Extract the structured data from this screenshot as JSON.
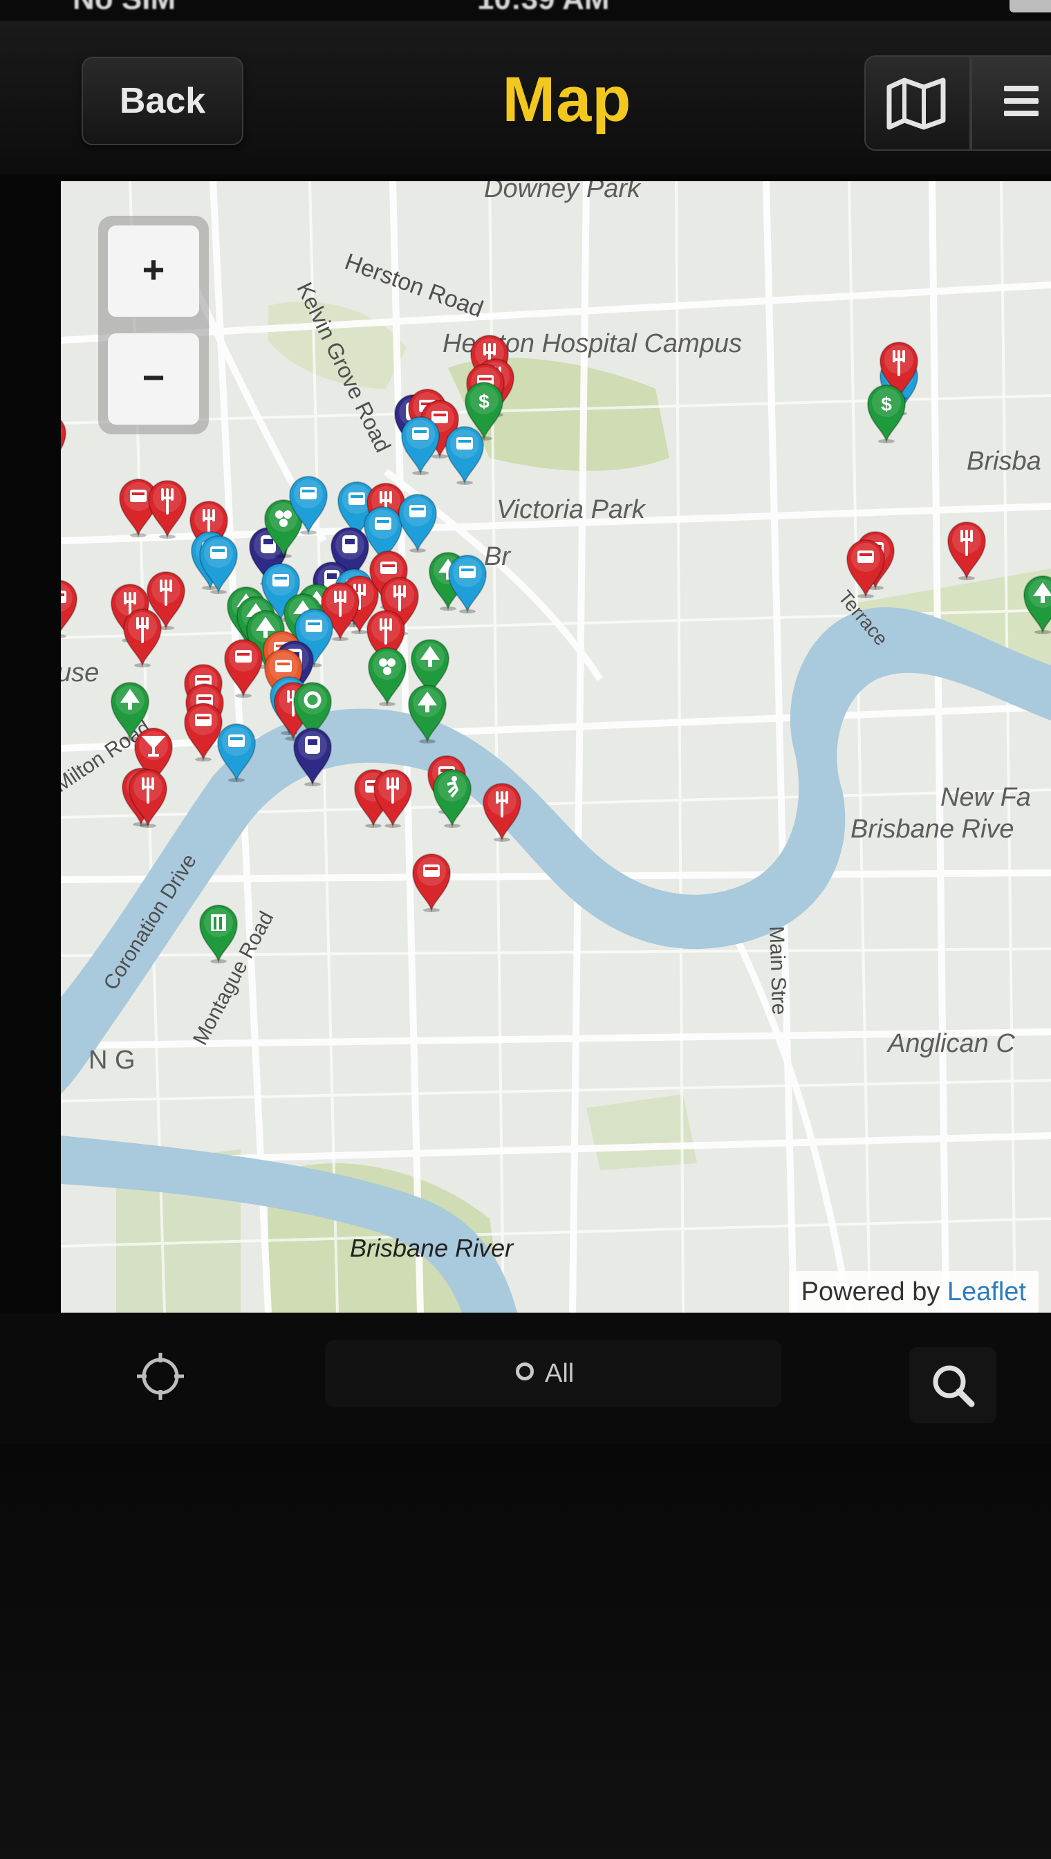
{
  "status_bar": {
    "carrier": "No SIM",
    "time": "10:39 AM"
  },
  "nav": {
    "back_label": "Back",
    "title": "Map"
  },
  "map": {
    "labels": {
      "downey_park": "Downey Park",
      "herston_road": "Herston Road",
      "kelvin_grove_road": "Kelvin Grove Road",
      "herston_hospital": "Herston Hospital Campus",
      "brisbane_right": "Brisba",
      "victoria_park": "Victoria Park",
      "br_fragment": "Br",
      "use_fragment": "use",
      "milton_road": "Milton Road",
      "coronation_drive": "Coronation Drive",
      "montague_road": "Montague Road",
      "ng_fragment": "N G",
      "new_farm": "New Fa",
      "brisbane_river_east": "Brisbane Rive",
      "main_street": "Main Stre",
      "anglican": "Anglican C",
      "brisbane_river_south": "Brisbane River",
      "wickham_terrace_fragment": "Terrace"
    },
    "zoom_in": "+",
    "zoom_out": "−",
    "attribution_prefix": "Powered by",
    "attribution_link": "Leaflet",
    "colors": {
      "red": "#d9262b",
      "blue": "#1f9fd9",
      "green": "#1f9a3c",
      "purple": "#2e2a86",
      "orange": "#e9572b",
      "water": "#a9c9dc",
      "park": "#cfdcb4"
    }
  },
  "toolbar": {
    "filter_label": "All"
  }
}
